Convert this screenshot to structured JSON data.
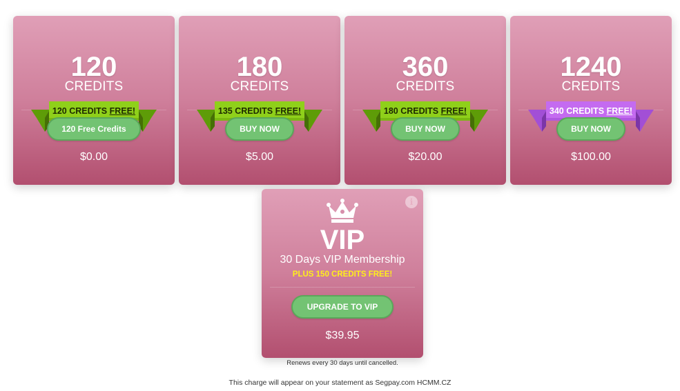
{
  "packages": [
    {
      "amount": "120",
      "unit": "CREDITS",
      "ribbon_prefix": "120 CREDITS ",
      "ribbon_free": "FREE!",
      "button": "120 Free Credits",
      "price": "$0.00",
      "ribbon_color": "green"
    },
    {
      "amount": "180",
      "unit": "CREDITS",
      "ribbon_prefix": "135 CREDITS ",
      "ribbon_free": "FREE!",
      "button": "BUY NOW",
      "price": "$5.00",
      "ribbon_color": "green"
    },
    {
      "amount": "360",
      "unit": "CREDITS",
      "ribbon_prefix": "180 CREDITS ",
      "ribbon_free": "FREE!",
      "button": "BUY NOW",
      "price": "$20.00",
      "ribbon_color": "green"
    },
    {
      "amount": "1240",
      "unit": "CREDITS",
      "ribbon_prefix": "340 CREDITS ",
      "ribbon_free": "FREE!",
      "button": "BUY NOW",
      "price": "$100.00",
      "ribbon_color": "purple"
    }
  ],
  "vip": {
    "title": "VIP",
    "subtitle": "30 Days VIP Membership",
    "bonus": "PLUS 150 CREDITS FREE!",
    "button": "UPGRADE TO VIP",
    "price": "$39.95",
    "renew_note": "Renews every 30 days until cancelled.",
    "info_icon": "i"
  },
  "statement": "This charge will appear on your statement as Segpay.com HCMM.CZ",
  "icons": {
    "crown": "crown-icon",
    "info": "info-icon"
  },
  "colors": {
    "card_top": "#e09fb7",
    "card_bottom": "#b24f6f",
    "button_green": "#73c373",
    "ribbon_green": "#8fd01a",
    "ribbon_purple": "#c46bf0",
    "bonus_yellow": "#ffef1a"
  }
}
